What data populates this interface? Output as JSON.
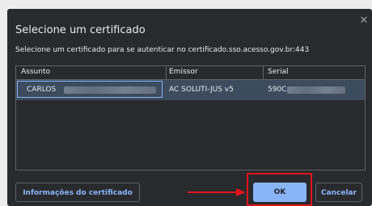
{
  "dialog": {
    "title": "Selecione um certificado",
    "subtitle": "Selecione um certificado para se autenticar no certificado.sso.acesso.gov.br:443",
    "close_icon": "✕"
  },
  "table": {
    "headers": [
      "Assunto",
      "Emissor",
      "Serial"
    ],
    "rows": [
      {
        "subject": "CARLOS",
        "issuer": "AC SOLUTI-JUS v5",
        "serial": "590C"
      }
    ]
  },
  "buttons": {
    "info": "Informações do certificado",
    "ok": "OK",
    "cancel": "Cancelar"
  },
  "annotation": {
    "color": "#e0131b"
  },
  "colors": {
    "dialog_bg": "#292a2d",
    "accent": "#8ab4f8",
    "selected_row": "#3c4b5e"
  }
}
